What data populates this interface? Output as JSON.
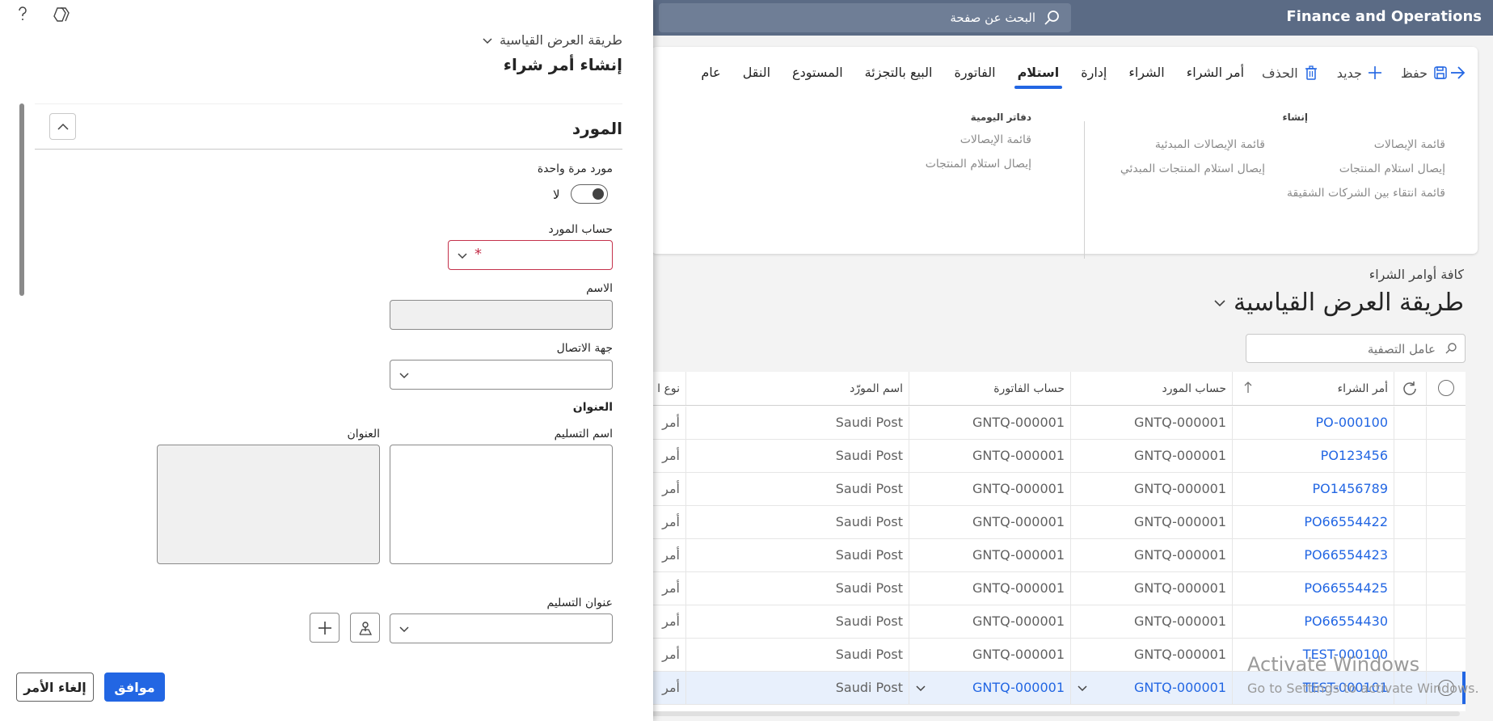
{
  "app": {
    "title": "Finance and Operations",
    "search_placeholder": "البحث عن صفحة"
  },
  "action_pane": {
    "buttons": {
      "save": "حفظ",
      "new": "جديد",
      "delete": "الحذف"
    },
    "tabs": [
      "أمر الشراء",
      "الشراء",
      "إدارة",
      "استلام",
      "الفاتورة",
      "البيع بالتجزئة",
      "المستودع",
      "النقل",
      "عام"
    ],
    "active_tab": "استلام",
    "groups": {
      "create": {
        "title": "إنشاء",
        "col1": [
          "قائمة الإيصالات",
          "إيصال استلام المنتجات",
          "قائمة انتقاء بين الشركات الشقيقة"
        ],
        "col2": [
          "قائمة الإيصالات المبدئية",
          "إيصال استلام المنتجات المبدئي"
        ]
      },
      "journals": {
        "title": "دفاتر اليومية",
        "items": [
          "قائمة الإيصالات",
          "إيصال استلام المنتجات"
        ]
      }
    }
  },
  "list_page": {
    "breadcrumb": "كافة أوامر الشراء",
    "view_name": "طريقة العرض القياسية",
    "filter_placeholder": "عامل التصفية"
  },
  "grid": {
    "columns": {
      "purchase_order": "أمر الشراء",
      "vendor_account": "حساب المورد",
      "invoice_account": "حساب الفاتورة",
      "vendor_name": "اسم المورّد",
      "type": "نوع ا"
    },
    "rows": [
      {
        "po": "PO-000100",
        "vendor": "GNTQ-000001",
        "invoice": "GNTQ-000001",
        "name": "Saudi Post",
        "type": "أمر"
      },
      {
        "po": "PO123456",
        "vendor": "GNTQ-000001",
        "invoice": "GNTQ-000001",
        "name": "Saudi Post",
        "type": "أمر"
      },
      {
        "po": "PO1456789",
        "vendor": "GNTQ-000001",
        "invoice": "GNTQ-000001",
        "name": "Saudi Post",
        "type": "أمر"
      },
      {
        "po": "PO66554422",
        "vendor": "GNTQ-000001",
        "invoice": "GNTQ-000001",
        "name": "Saudi Post",
        "type": "أمر"
      },
      {
        "po": "PO66554423",
        "vendor": "GNTQ-000001",
        "invoice": "GNTQ-000001",
        "name": "Saudi Post",
        "type": "أمر"
      },
      {
        "po": "PO66554425",
        "vendor": "GNTQ-000001",
        "invoice": "GNTQ-000001",
        "name": "Saudi Post",
        "type": "أمر"
      },
      {
        "po": "PO66554430",
        "vendor": "GNTQ-000001",
        "invoice": "GNTQ-000001",
        "name": "Saudi Post",
        "type": "أمر"
      },
      {
        "po": "TEST-000100",
        "vendor": "GNTQ-000001",
        "invoice": "GNTQ-000001",
        "name": "Saudi Post",
        "type": "أمر"
      },
      {
        "po": "TEST-000101",
        "vendor": "GNTQ-000001",
        "invoice": "GNTQ-000001",
        "name": "Saudi Post",
        "type": "أمر"
      }
    ]
  },
  "watermark": {
    "line1": "Activate Windows",
    "line2": "Go to Settings to activate Windows."
  },
  "panel": {
    "view_name": "طريقة العرض القياسية",
    "title": "إنشاء أمر شراء",
    "section_title": "المورد",
    "one_time_vendor": {
      "label": "مورد مرة واحدة",
      "value": "لا"
    },
    "vendor_account": {
      "label": "حساب المورد",
      "required_mark": "*"
    },
    "name_label": "الاسم",
    "contact_label": "جهة الاتصال",
    "address_section": "العنوان",
    "delivery_name_label": "اسم التسليم",
    "address_label": "العنوان",
    "delivery_address_label": "عنوان التسليم",
    "ok_label": "موافق",
    "cancel_label": "إلغاء الأمر"
  },
  "colors": {
    "accent": "#2266e3",
    "topbar": "#5b6b85",
    "error": "#c4314b"
  }
}
